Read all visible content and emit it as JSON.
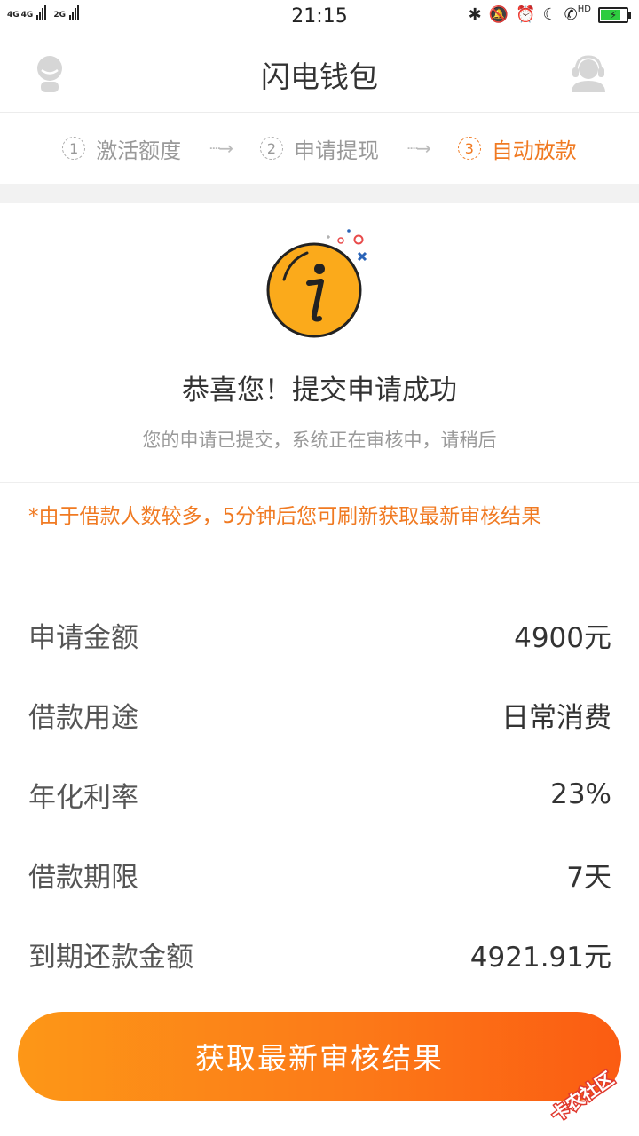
{
  "status_bar": {
    "net1": "4G",
    "net2": "4G",
    "net3": "2G",
    "time": "21:15",
    "hd": "HD"
  },
  "header": {
    "title": "闪电钱包",
    "left_icon": "user-avatar-icon",
    "right_icon": "customer-service-icon"
  },
  "steps": [
    {
      "num": "1",
      "label": "激活额度"
    },
    {
      "num": "2",
      "label": "申请提现"
    },
    {
      "num": "3",
      "label": "自动放款"
    }
  ],
  "arrow": "┈→",
  "result": {
    "title": "恭喜您！提交申请成功",
    "subtitle": "您的申请已提交，系统正在审核中，请稍后"
  },
  "notice": "*由于借款人数较多，5分钟后您可刷新获取最新审核结果",
  "details": [
    {
      "label": "申请金额",
      "value": "4900元"
    },
    {
      "label": "借款用途",
      "value": "日常消费"
    },
    {
      "label": "年化利率",
      "value": "23%"
    },
    {
      "label": "借款期限",
      "value": "7天"
    },
    {
      "label": "到期还款金额",
      "value": "4921.91元"
    }
  ],
  "cta_label": "获取最新审核结果",
  "watermark": "卡农社区",
  "colors": {
    "accent": "#f07a22",
    "button_start": "#fd9717",
    "button_end": "#fb5c12"
  }
}
